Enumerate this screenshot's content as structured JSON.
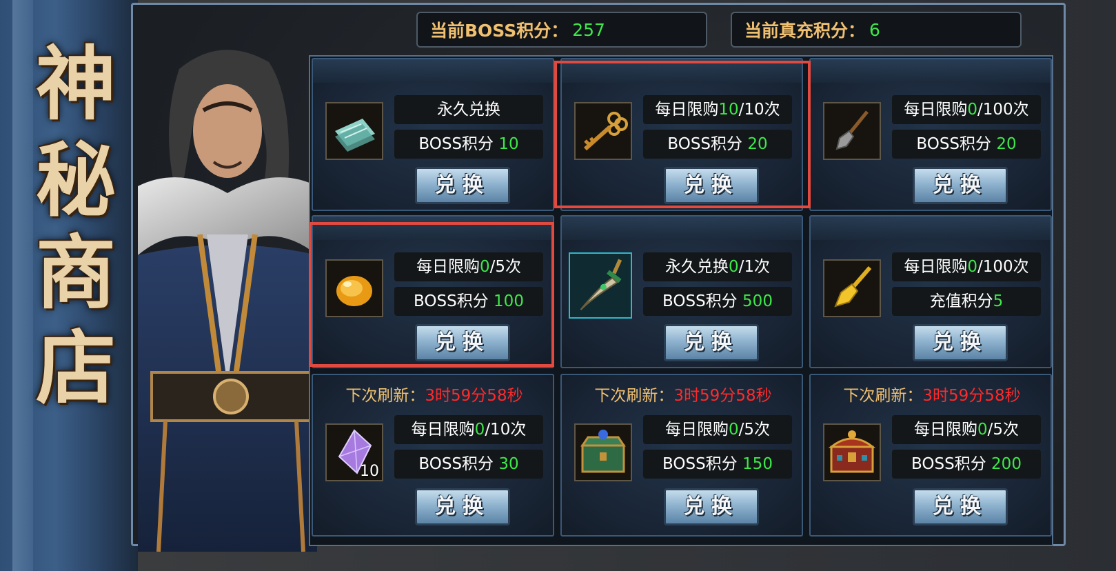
{
  "shop_title": [
    "神",
    "秘",
    "商",
    "店"
  ],
  "header": {
    "boss_score_label": "当前BOSS积分：",
    "boss_score_value": "257",
    "recharge_score_label": "当前真充积分：",
    "recharge_score_value": "6"
  },
  "items": [
    {
      "icon": "jade-token-icon",
      "line1_pre": "永久兑换",
      "line1_num": "",
      "line1_post": "",
      "line2_pre": "BOSS积分 ",
      "line2_num": "10",
      "button": "兑换"
    },
    {
      "icon": "golden-key-icon",
      "line1_pre": "每日限购",
      "line1_num": "10",
      "line1_post": "/10次",
      "line2_pre": "BOSS积分 ",
      "line2_num": "20",
      "button": "兑换"
    },
    {
      "icon": "shovel-icon",
      "line1_pre": "每日限购",
      "line1_num": "0",
      "line1_post": "/100次",
      "line2_pre": "BOSS积分 ",
      "line2_num": "20",
      "button": "兑换"
    },
    {
      "icon": "amber-stone-icon",
      "line1_pre": "每日限购",
      "line1_num": "0",
      "line1_post": "/5次",
      "line2_pre": "BOSS积分 ",
      "line2_num": "100",
      "button": "兑换"
    },
    {
      "icon": "jade-dagger-icon",
      "line1_pre": "永久兑换",
      "line1_num": "0",
      "line1_post": "/1次",
      "line2_pre": "BOSS积分 ",
      "line2_num": "500",
      "button": "兑换"
    },
    {
      "icon": "golden-shovel-icon",
      "line1_pre": "每日限购",
      "line1_num": "0",
      "line1_post": "/100次",
      "line2_pre": "充值积分",
      "line2_num": "5",
      "button": "兑换"
    },
    {
      "icon": "purple-gem-icon",
      "count": "10",
      "refresh_label": "下次刷新：",
      "refresh_time": "3时59分58秒",
      "line1_pre": "每日限购",
      "line1_num": "0",
      "line1_post": "/10次",
      "line2_pre": "BOSS积分 ",
      "line2_num": "30",
      "button": "兑换"
    },
    {
      "icon": "green-chest-icon",
      "refresh_label": "下次刷新：",
      "refresh_time": "3时59分58秒",
      "line1_pre": "每日限购",
      "line1_num": "0",
      "line1_post": "/5次",
      "line2_pre": "BOSS积分 ",
      "line2_num": "150",
      "button": "兑换"
    },
    {
      "icon": "red-chest-icon",
      "refresh_label": "下次刷新：",
      "refresh_time": "3时59分58秒",
      "line1_pre": "每日限购",
      "line1_num": "0",
      "line1_post": "/5次",
      "line2_pre": "BOSS积分 ",
      "line2_num": "200",
      "button": "兑换"
    }
  ],
  "colors": {
    "green_value": "#3ee84a",
    "gold_label": "#f0c070",
    "red_timer": "#ff2a2a",
    "highlight": "#e24a3f"
  }
}
